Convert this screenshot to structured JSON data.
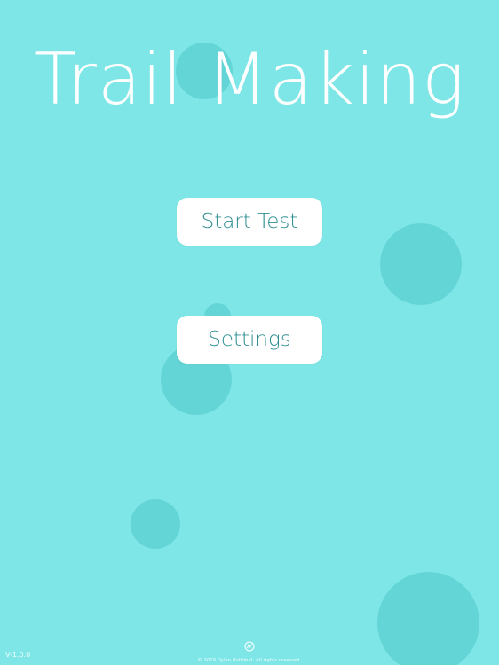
{
  "app": {
    "title": "Trail Making"
  },
  "menu": {
    "start_label": "Start Test",
    "settings_label": "Settings"
  },
  "footer": {
    "version": "V-1.0.0",
    "copyright": "© 2019 Dylan Rothfeld. All rights reserved."
  },
  "colors": {
    "background": "#7ee6e6",
    "bubble": "#5ccfd1",
    "button_bg": "#ffffff",
    "button_text": "#2f8f93",
    "title_text": "#ffffff"
  },
  "icons": {
    "footer_logo": "dr-logo-icon"
  }
}
